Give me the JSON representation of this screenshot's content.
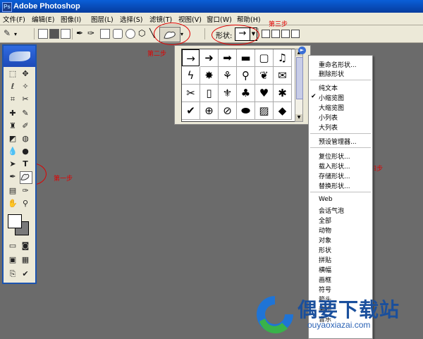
{
  "app": {
    "title": "Adobe Photoshop"
  },
  "menubar": [
    "文件(F)",
    "编辑(E)",
    "图像(I)",
    "图层(L)",
    "选择(S)",
    "滤镜(T)",
    "视图(V)",
    "窗口(W)",
    "帮助(H)"
  ],
  "options_bar": {
    "shape_label": "形状:",
    "selected_shape": "→"
  },
  "annotations": {
    "step1": "第一步",
    "step2": "第二步",
    "step3": "第三步",
    "step4": "第四步"
  },
  "shape_picker": {
    "shapes": [
      "→",
      "➜",
      "➡",
      "▬",
      "▢",
      "♫",
      "ϟ",
      "✸",
      "⚘",
      "⚲",
      "❦",
      "✉",
      "✂",
      "▯",
      "⚜",
      "♣",
      "♥",
      "✱",
      "✔",
      "⊕",
      "⊘",
      "⬬",
      "▨",
      "◆"
    ]
  },
  "menu": {
    "items_group1": [
      "重命名形状...",
      "删除形状"
    ],
    "items_group2": [
      "纯文本",
      "小缩览图",
      "大缩览图",
      "小列表",
      "大列表"
    ],
    "checked_item": "小缩览图",
    "items_group3": [
      "预设管理器..."
    ],
    "items_group4": [
      "复位形状...",
      "载入形状...",
      "存储形状...",
      "替换形状..."
    ],
    "items_group5": [
      "Web",
      "会话气泡",
      "全部",
      "动物",
      "对象",
      "形状",
      "拼贴",
      "横幅",
      "画框",
      "符号",
      "箭头",
      "装饰",
      "音乐"
    ]
  },
  "watermark": {
    "text": "偶要下载站",
    "url": "ouyaoxiazai.com"
  },
  "colors": {
    "accent": "#0a5fd8",
    "annotation": "#e00000",
    "canvas": "#6b6b6b"
  }
}
